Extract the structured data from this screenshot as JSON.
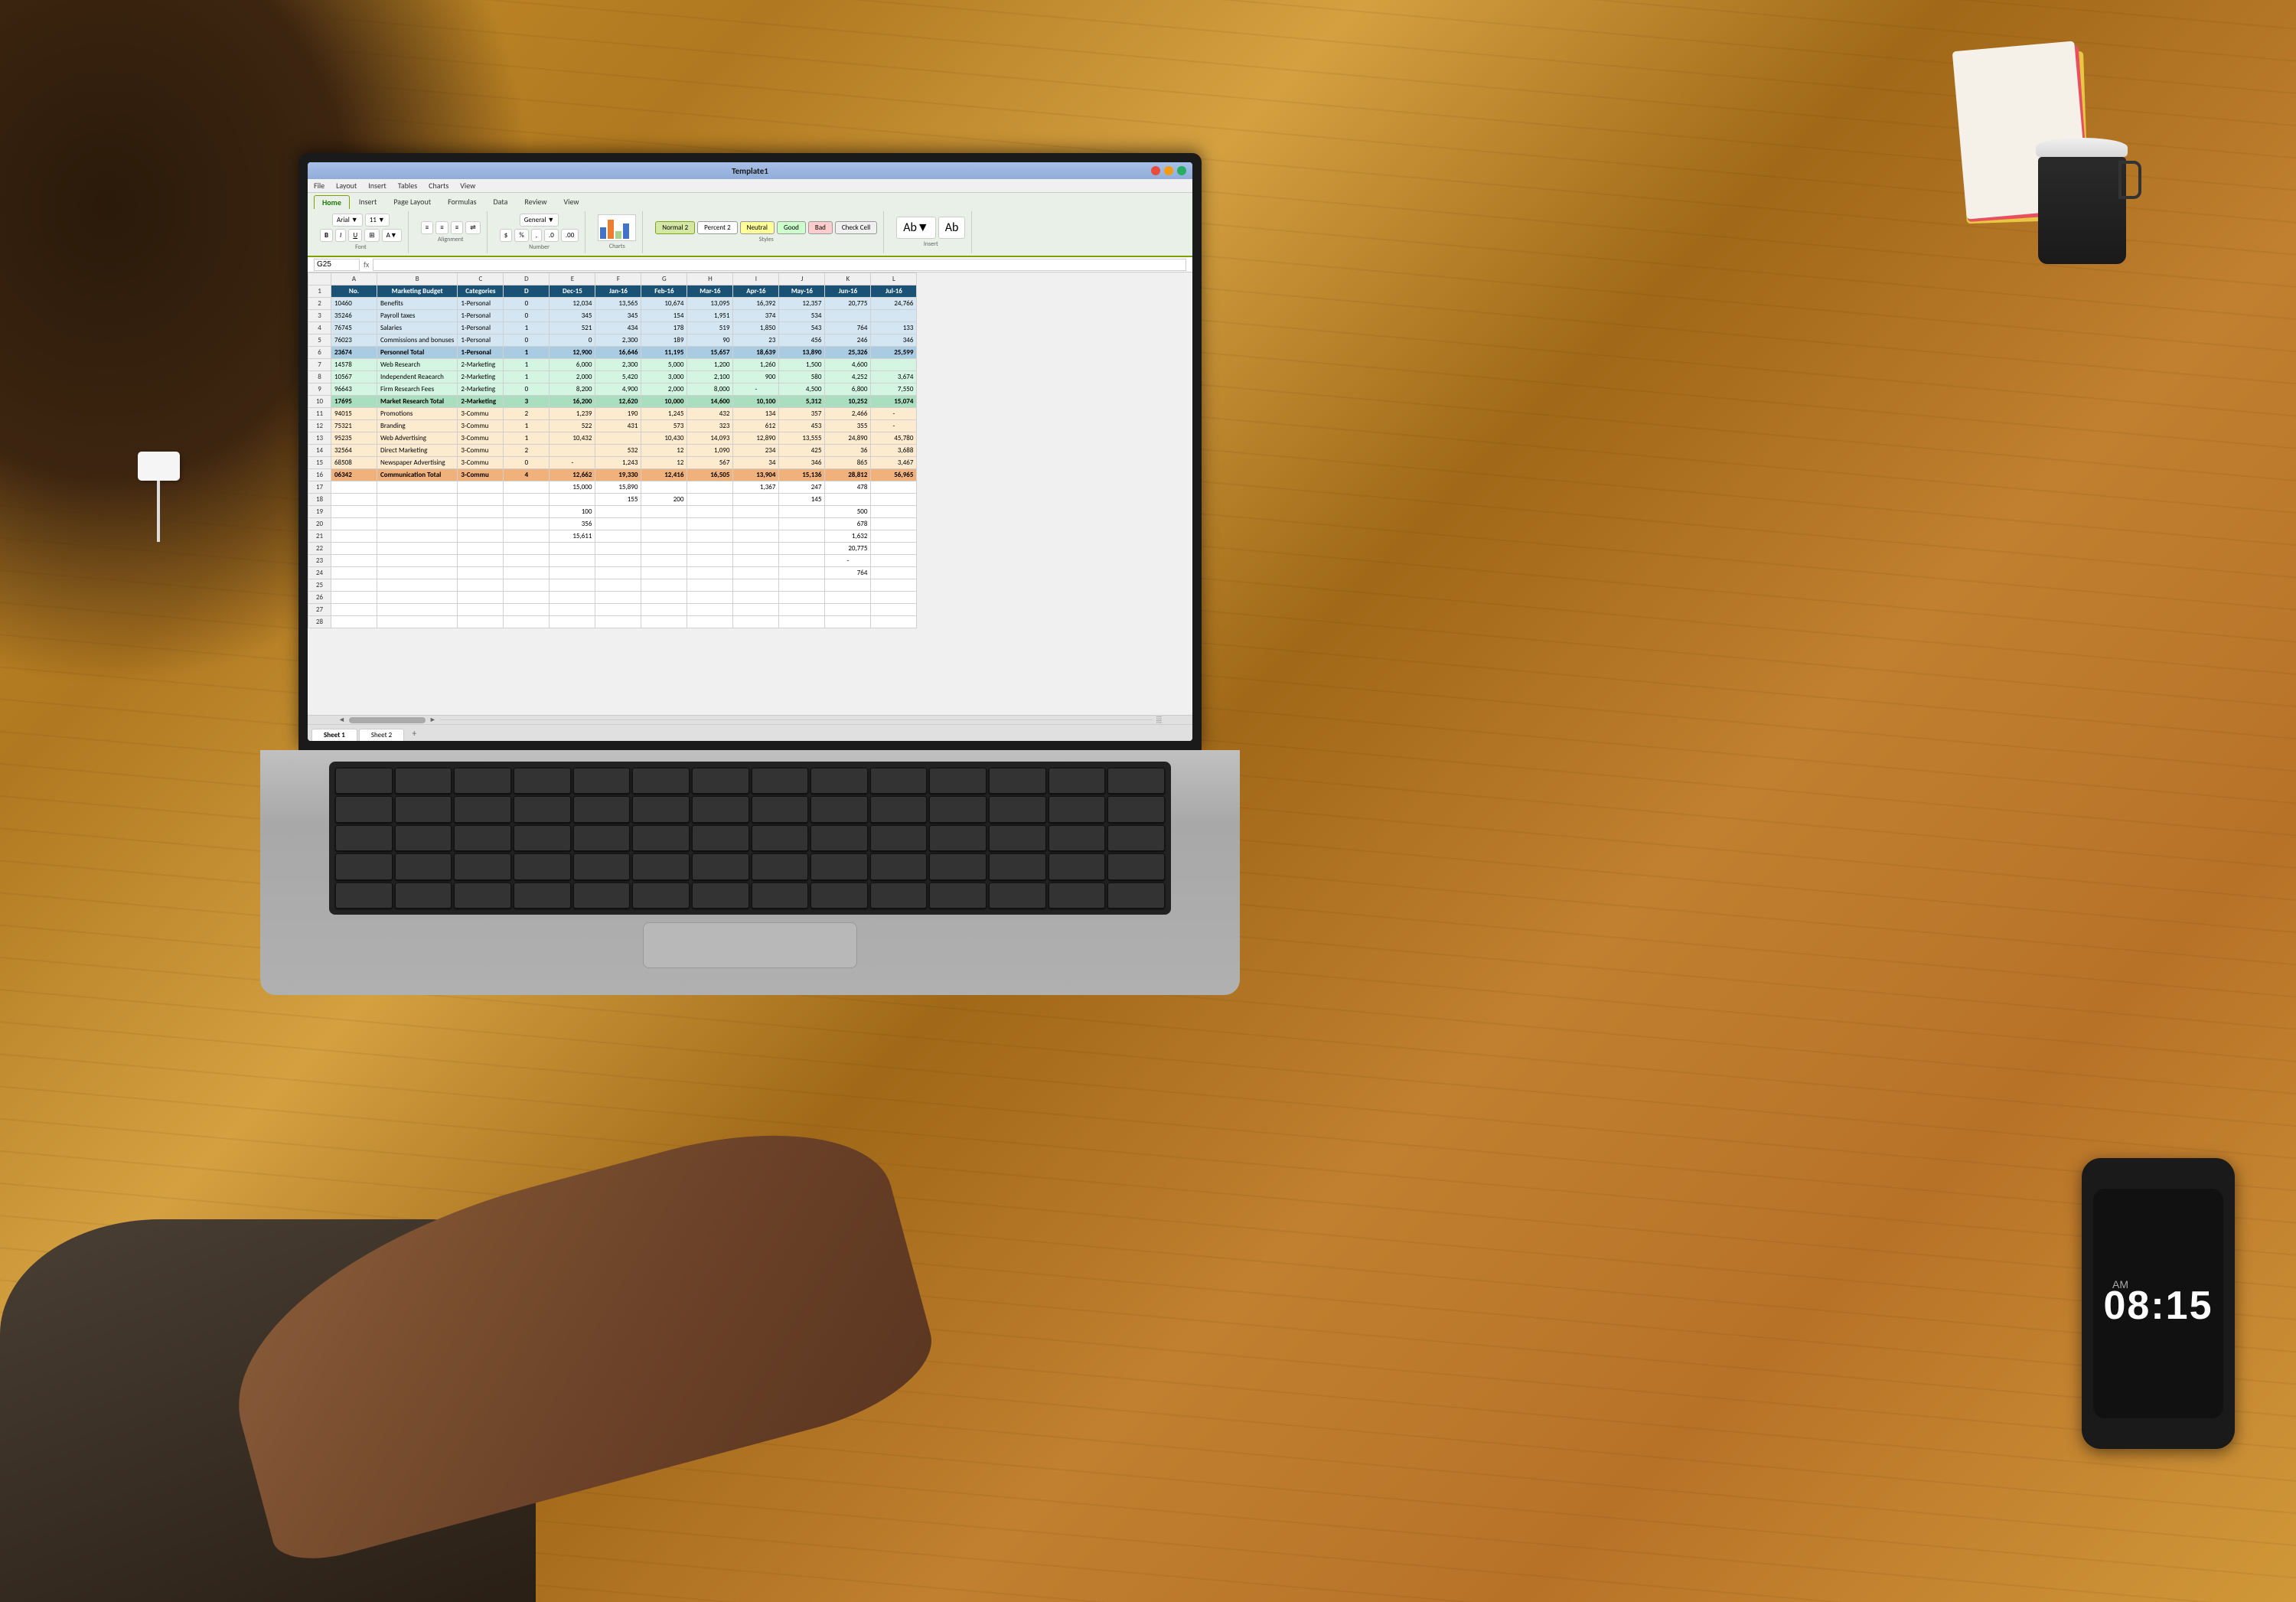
{
  "app": {
    "title": "Template1",
    "window_controls": [
      "red",
      "yellow",
      "green"
    ]
  },
  "menu": {
    "items": [
      "File",
      "Layout",
      "Insert",
      "Tables",
      "Charts",
      "View"
    ]
  },
  "ribbon": {
    "tabs": [
      "Home",
      "Insert",
      "Page Layout",
      "Formulas",
      "Data",
      "Review",
      "View"
    ],
    "active_tab": "Home",
    "font_name": "Arial",
    "font_size": "11",
    "styles": {
      "normal": "Normal 2",
      "percent": "Percent 2",
      "neutral": "Neutral",
      "good": "Good",
      "bad": "Bad",
      "check": "Check Cell"
    }
  },
  "formula_bar": {
    "cell_ref": "G25",
    "formula": ""
  },
  "spreadsheet": {
    "columns": [
      "",
      "A",
      "B",
      "C",
      "D",
      "E",
      "F",
      "G",
      "H",
      "I",
      "J",
      "K",
      "L"
    ],
    "col_headers": [
      "No.",
      "Marketing Budget",
      "Categories",
      "D",
      "Dec-15",
      "Jan-16",
      "Feb-16",
      "Mar-16",
      "Apr-16",
      "May-16",
      "Jun-16",
      "Jul-16"
    ],
    "rows": [
      {
        "row": 1,
        "type": "header",
        "cells": [
          "No.",
          "Marketing Budget",
          "Categories",
          "D",
          "Dec-15",
          "Jan-16",
          "Feb-16",
          "Mar-16",
          "Apr-16",
          "May-16",
          "Jun-16",
          "Jul-16"
        ]
      },
      {
        "row": 2,
        "type": "personal",
        "cells": [
          "10460",
          "Benefits",
          "1-Personal",
          "0",
          "12,034",
          "13,565",
          "10,674",
          "13,095",
          "16,392",
          "12,357",
          "20,775",
          "24,766"
        ]
      },
      {
        "row": 3,
        "type": "personal",
        "cells": [
          "35246",
          "Payroll taxes",
          "1-Personal",
          "0",
          "345",
          "345",
          "154",
          "1,951",
          "374",
          "534",
          "",
          ""
        ]
      },
      {
        "row": 4,
        "type": "personal",
        "cells": [
          "76745",
          "Salaries",
          "1-Personal",
          "1",
          "521",
          "434",
          "178",
          "519",
          "1,850",
          "543",
          "764",
          "133"
        ]
      },
      {
        "row": 5,
        "type": "personal",
        "cells": [
          "76023",
          "Commissions and bonuses",
          "1-Personal",
          "0",
          "0",
          "2,300",
          "189",
          "90",
          "23",
          "456",
          "246",
          "346"
        ]
      },
      {
        "row": 6,
        "type": "total",
        "cells": [
          "23674",
          "Personnel Total",
          "1-Personal",
          "1",
          "12,900",
          "16,646",
          "11,195",
          "15,657",
          "18,639",
          "13,890",
          "25,326",
          "25,599"
        ]
      },
      {
        "row": 7,
        "type": "marketing",
        "cells": [
          "14578",
          "Web Research",
          "2-Marketing",
          "1",
          "6,000",
          "2,300",
          "5,000",
          "1,200",
          "1,260",
          "1,500",
          "4,600",
          ""
        ]
      },
      {
        "row": 8,
        "type": "marketing",
        "cells": [
          "10567",
          "Independent Reaearch",
          "2-Marketing",
          "1",
          "2,000",
          "5,420",
          "3,000",
          "2,100",
          "900",
          "580",
          "4,252",
          "3,674"
        ]
      },
      {
        "row": 9,
        "type": "marketing",
        "cells": [
          "96643",
          "Firm Research Fees",
          "2-Marketing",
          "0",
          "8,200",
          "4,900",
          "2,000",
          "8,000",
          "-",
          "4,500",
          "6,800",
          "7,550"
        ]
      },
      {
        "row": 10,
        "type": "marketing-total",
        "cells": [
          "17695",
          "Market Research Total",
          "2-Marketing",
          "3",
          "16,200",
          "12,620",
          "10,000",
          "14,600",
          "10,100",
          "5,312",
          "10,252",
          "15,074"
        ]
      },
      {
        "row": 11,
        "type": "commu",
        "cells": [
          "94015",
          "Promotions",
          "3-Commu",
          "2",
          "1,239",
          "190",
          "1,245",
          "432",
          "134",
          "357",
          "2,466",
          "-"
        ]
      },
      {
        "row": 12,
        "type": "commu",
        "cells": [
          "75321",
          "Branding",
          "3-Commu",
          "1",
          "522",
          "431",
          "573",
          "323",
          "612",
          "453",
          "355",
          "-"
        ]
      },
      {
        "row": 13,
        "type": "commu",
        "cells": [
          "95235",
          "Web Advertising",
          "3-Commu",
          "1",
          "10,432",
          "",
          "10,430",
          "14,093",
          "12,890",
          "13,555",
          "24,890",
          "45,780"
        ]
      },
      {
        "row": 14,
        "type": "commu",
        "cells": [
          "32564",
          "Direct Marketing",
          "3-Commu",
          "2",
          "",
          "532",
          "12",
          "1,090",
          "234",
          "425",
          "36",
          "3,688"
        ]
      },
      {
        "row": 15,
        "type": "commu",
        "cells": [
          "68508",
          "Newspaper Advertising",
          "3-Commu",
          "0",
          "-",
          "1,243",
          "12",
          "567",
          "34",
          "346",
          "865",
          "3,467"
        ]
      },
      {
        "row": 16,
        "type": "commu-total",
        "cells": [
          "06342",
          "Communication Total",
          "3-Commu",
          "4",
          "12,662",
          "19,330",
          "12,416",
          "16,505",
          "13,904",
          "15,136",
          "28,812",
          "56,965"
        ]
      },
      {
        "row": 17,
        "type": "empty",
        "cells": [
          "",
          "",
          "",
          "",
          "15,000",
          "15,890",
          "",
          "",
          "1,367",
          "247",
          "478",
          ""
        ]
      },
      {
        "row": 18,
        "type": "empty",
        "cells": [
          "",
          "",
          "",
          "",
          "",
          "155",
          "200",
          "",
          "",
          "145",
          "",
          ""
        ]
      },
      {
        "row": 19,
        "type": "empty",
        "cells": [
          "",
          "",
          "",
          "",
          "100",
          "",
          "",
          "",
          "",
          "",
          "500",
          ""
        ]
      },
      {
        "row": 20,
        "type": "empty",
        "cells": [
          "",
          "",
          "",
          "",
          "356",
          "",
          "",
          "",
          "",
          "",
          "678",
          ""
        ]
      },
      {
        "row": 21,
        "type": "empty",
        "cells": [
          "",
          "",
          "",
          "",
          "15,611",
          "",
          "",
          "",
          "",
          "",
          "1,632",
          ""
        ]
      },
      {
        "row": 22,
        "type": "empty",
        "cells": [
          "",
          "",
          "",
          "",
          "",
          "",
          "",
          "",
          "",
          "",
          "20,775",
          ""
        ]
      },
      {
        "row": 23,
        "type": "empty",
        "cells": [
          "",
          "",
          "",
          "",
          "",
          "",
          "",
          "",
          "",
          "",
          "-",
          ""
        ]
      },
      {
        "row": 24,
        "type": "empty",
        "cells": [
          "",
          "",
          "",
          "",
          "",
          "",
          "",
          "",
          "",
          "",
          "764",
          ""
        ]
      },
      {
        "row": 25,
        "type": "empty",
        "cells": []
      },
      {
        "row": 26,
        "type": "empty",
        "cells": []
      },
      {
        "row": 27,
        "type": "empty",
        "cells": []
      },
      {
        "row": 28,
        "type": "empty",
        "cells": []
      }
    ]
  },
  "sheets": {
    "tabs": [
      "Sheet 1",
      "Sheet 2"
    ],
    "active": "Sheet 1"
  },
  "phone": {
    "time": "08:15",
    "ampm": "AM"
  },
  "decorative": {
    "coffee_visible": true,
    "notebooks_visible": true
  }
}
